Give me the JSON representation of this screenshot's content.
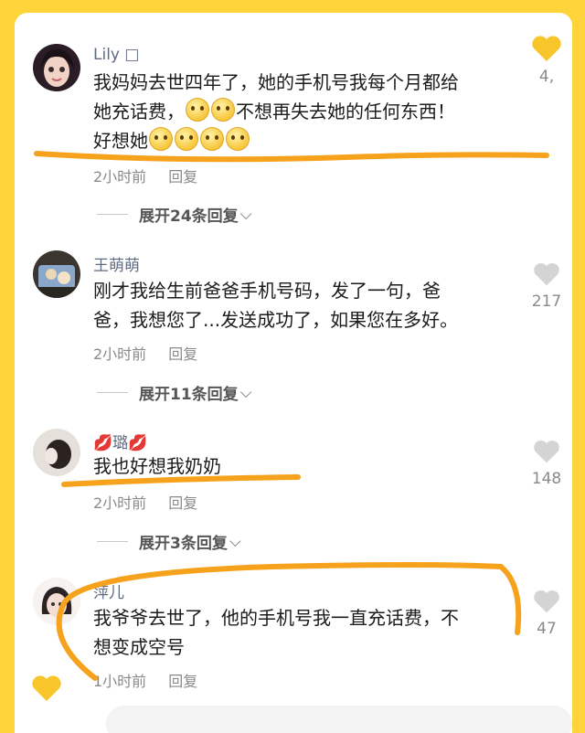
{
  "colors": {
    "background": "#FFD43B",
    "highlight": "#F6A21C",
    "name": "#5f6b82"
  },
  "comments": [
    {
      "name": "Lily",
      "name_suffix": "□",
      "text_line1": "我妈妈去世四年了，她的手机号我每个月都给",
      "text_line2_a": "她充话费，",
      "text_line2_b": "不想再失去她的任何东西！",
      "text_line3": "好想她",
      "time": "2小时前",
      "reply": "回复",
      "expand": "展开24条回复",
      "likes": "4,",
      "liked": true
    },
    {
      "name": "王萌萌",
      "text_line1": "刚才我给生前爸爸手机号码，发了一句，爸",
      "text_line2": "爸，我想您了...发送成功了，如果您在多好。",
      "time": "2小时前",
      "reply": "回复",
      "expand": "展开11条回复",
      "likes": "217"
    },
    {
      "name_prefix": "💋",
      "name": "璐",
      "name_suffix": "💋",
      "text_line1": "我也好想我奶奶",
      "time": "2小时前",
      "reply": "回复",
      "expand": "展开3条回复",
      "likes": "148"
    },
    {
      "name": "萍儿",
      "text_line1": "我爷爷去世了，他的手机号我一直充话费，不",
      "text_line2": "想变成空号",
      "time": "1小时前",
      "reply": "回复",
      "likes": "47"
    }
  ],
  "expand_chevron": "⌵"
}
